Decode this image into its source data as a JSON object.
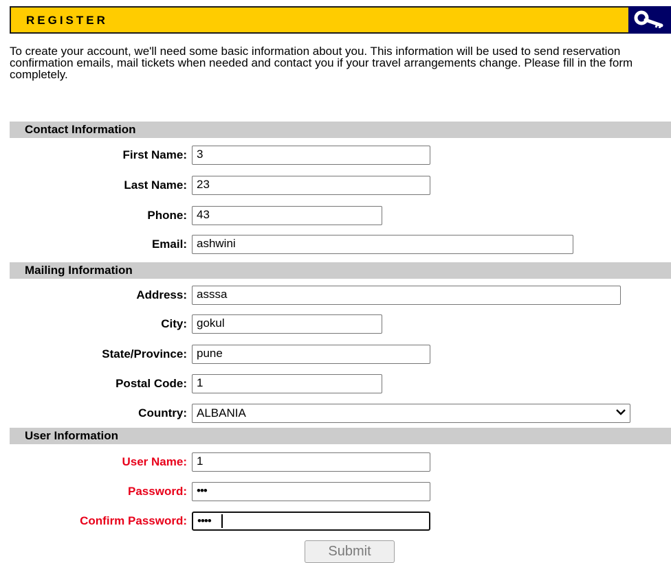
{
  "header": {
    "title": "REGISTER",
    "icon": "key-icon"
  },
  "intro": "To create your account, we'll need some basic information about you. This information will be used to send reservation confirmation emails, mail tickets when needed and contact you if your travel arrangements change. Please fill in the form completely.",
  "sections": {
    "contact": "Contact Information",
    "mailing": "Mailing Information",
    "user": "User Information"
  },
  "fields": {
    "first_name": {
      "label": "First Name:",
      "value": "3"
    },
    "last_name": {
      "label": "Last Name:",
      "value": "23"
    },
    "phone": {
      "label": "Phone:",
      "value": "43"
    },
    "email": {
      "label": "Email:",
      "value": "ashwini"
    },
    "address": {
      "label": "Address:",
      "value": "asssa"
    },
    "city": {
      "label": "City:",
      "value": "gokul"
    },
    "state": {
      "label": "State/Province:",
      "value": "pune"
    },
    "postal": {
      "label": "Postal Code:",
      "value": "1"
    },
    "country": {
      "label": "Country:",
      "value": "ALBANIA"
    },
    "user_name": {
      "label": "User Name:",
      "value": "1"
    },
    "password": {
      "label": "Password:",
      "value": "•••"
    },
    "confirm_password": {
      "label": "Confirm Password:",
      "value": "••••"
    }
  },
  "submit_label": "Submit",
  "colors": {
    "header_bg": "#ffcc00",
    "key_bg": "#000066",
    "required_label": "#e8001a",
    "section_bg": "#cccccc"
  }
}
